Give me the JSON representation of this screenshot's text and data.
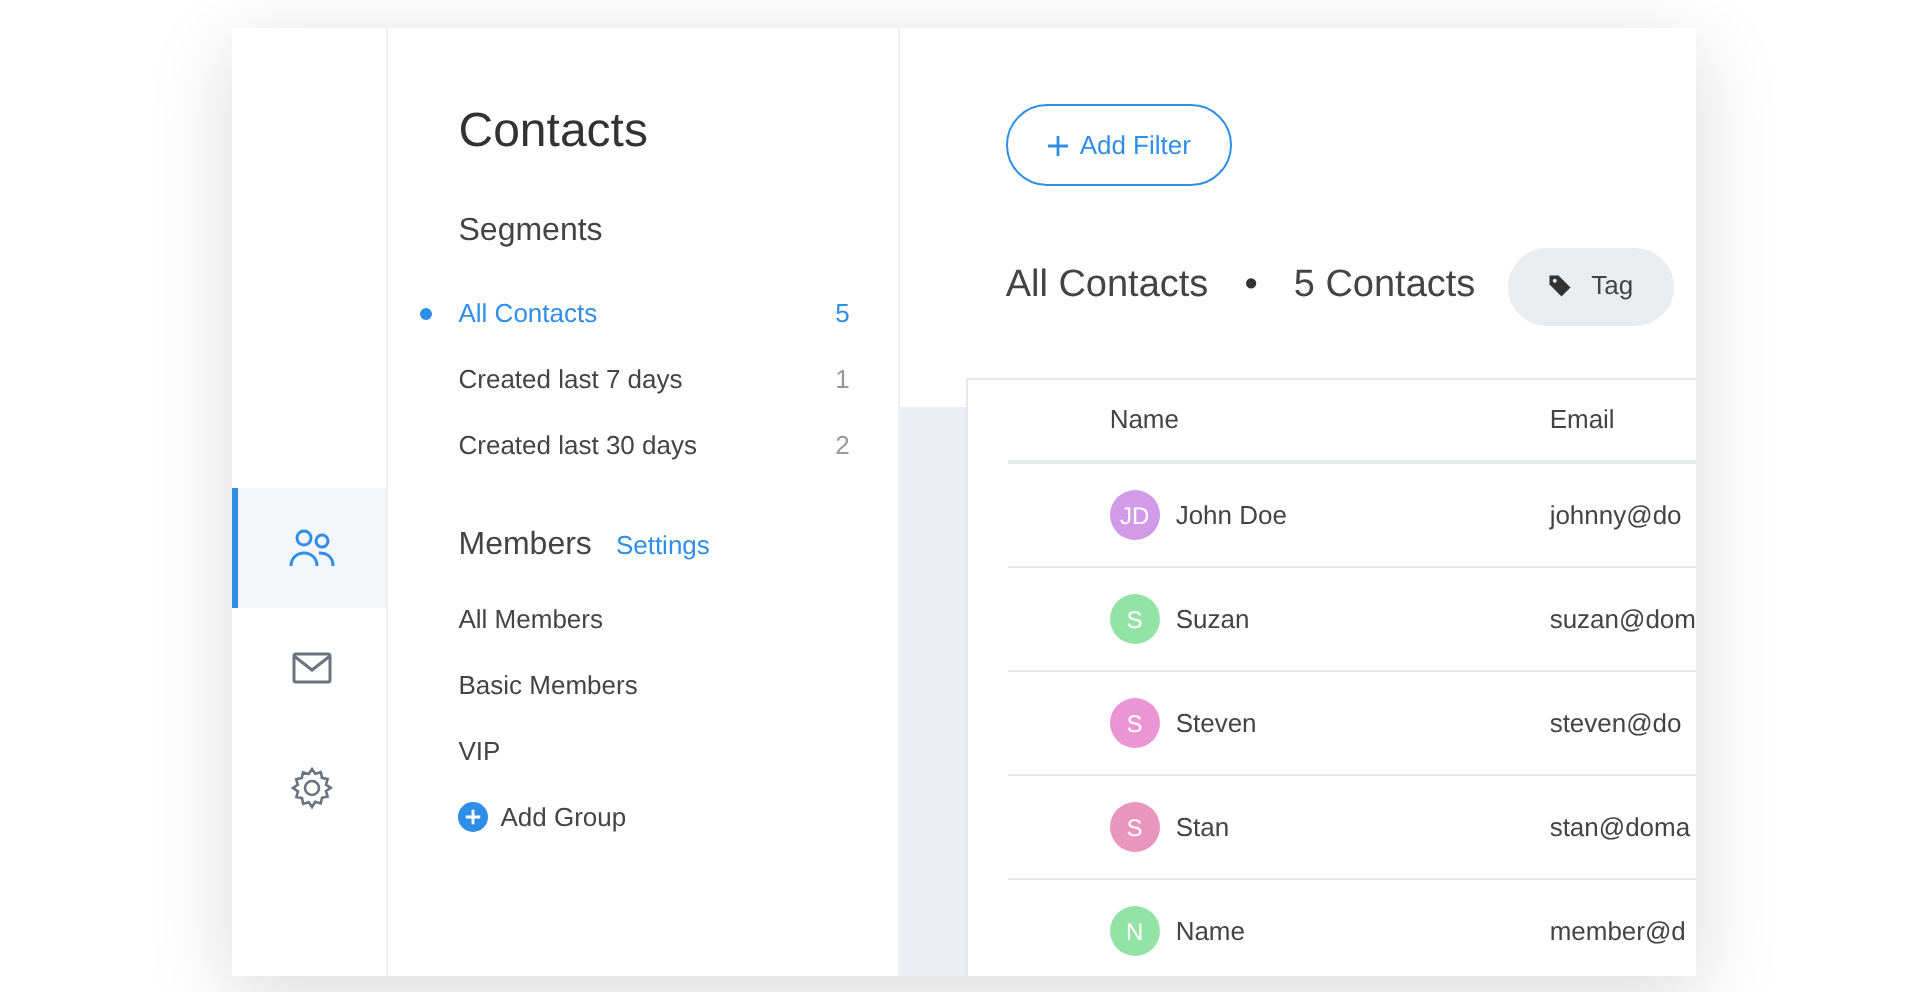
{
  "rail": [
    {
      "kind": "people",
      "selected": true
    },
    {
      "kind": "mail",
      "selected": false
    },
    {
      "kind": "gear",
      "selected": false
    }
  ],
  "title": "Contacts",
  "segments": {
    "heading": "Segments",
    "items": [
      {
        "label": "All Contacts",
        "count": "5",
        "selected": true
      },
      {
        "label": "Created last 7 days",
        "count": "1",
        "selected": false
      },
      {
        "label": "Created last 30 days",
        "count": "2",
        "selected": false
      }
    ]
  },
  "members": {
    "heading": "Members",
    "settings_link": "Settings",
    "items": [
      "All Members",
      "Basic Members",
      "VIP"
    ],
    "add_group": "Add Group"
  },
  "add_filter": "Add Filter",
  "list_title": "All Contacts",
  "separator": "•",
  "count": "5 Contacts",
  "tag_button": "Tag",
  "table": {
    "columns": [
      "Name",
      "Email"
    ],
    "rows": [
      {
        "initials": "JD",
        "color": "#d29be8",
        "name": "John Doe",
        "email": "johnny@do"
      },
      {
        "initials": "S",
        "color": "#94e3a6",
        "name": "Suzan",
        "email": "suzan@dom"
      },
      {
        "initials": "S",
        "color": "#ea96d4",
        "name": "Steven",
        "email": "steven@do"
      },
      {
        "initials": "S",
        "color": "#e896bd",
        "name": "Stan",
        "email": "stan@doma"
      },
      {
        "initials": "N",
        "color": "#94e3a6",
        "name": "Name",
        "email": "member@d"
      }
    ]
  }
}
